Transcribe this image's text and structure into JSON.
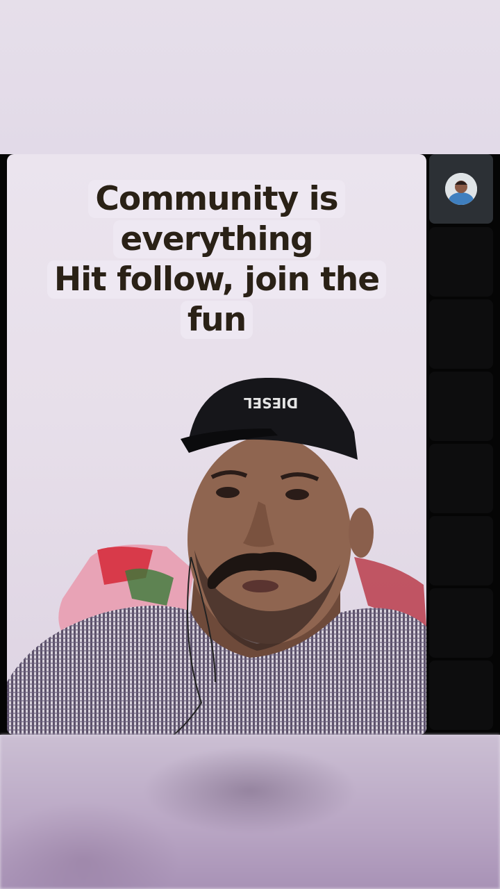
{
  "video_call": {
    "caption_lines": [
      "Community is",
      "everything",
      "Hit follow, join the",
      "fun"
    ],
    "cap_logo_text": "DIESEL",
    "participant_tiles_count_visible": 8
  },
  "colors": {
    "caption_text": "#2a2116",
    "caption_chip": "#eee8f2",
    "call_background": "#050505",
    "tile_background": "#0d0d0e",
    "active_tile": "#2c3035"
  }
}
